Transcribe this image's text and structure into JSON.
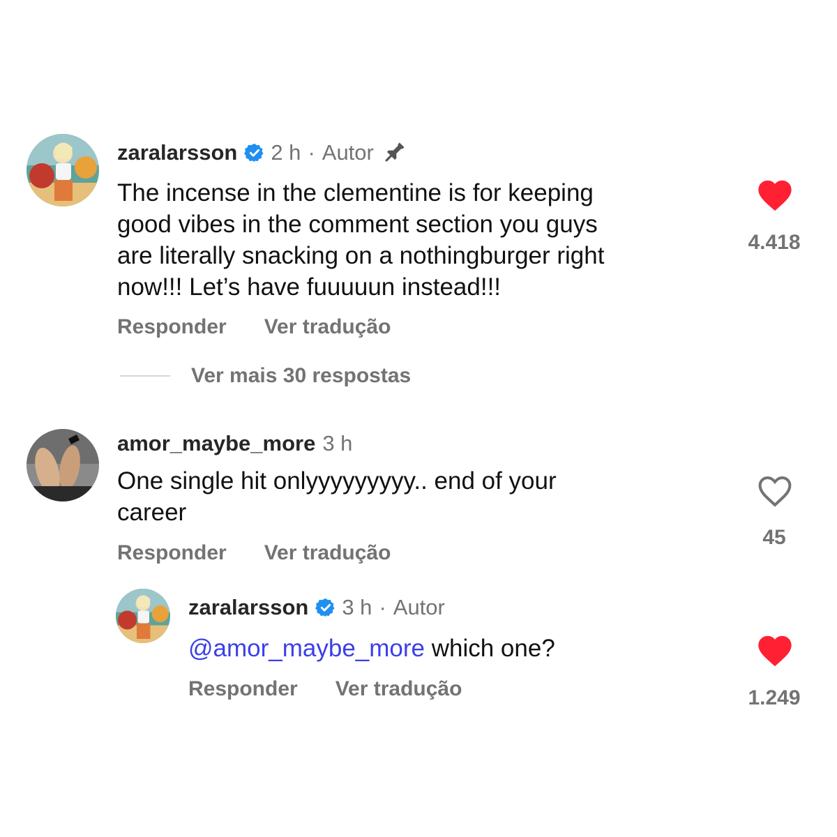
{
  "comments": [
    {
      "username": "zaralarsson",
      "verified": true,
      "time": "2 h",
      "separator": "·",
      "author_label": "Autor",
      "pinned": true,
      "text": "The incense in the clementine is for keeping\ngood vibes in the comment section you guys\nare literally snacking on a nothingburger right\nnow!!! Let’s have fuuuuun instead!!!",
      "reply_label": "Responder",
      "translate_label": "Ver tradução",
      "liked": true,
      "like_count": "4.418",
      "view_replies_label": "Ver mais 30 respostas"
    },
    {
      "username": "amor_maybe_more",
      "verified": false,
      "time": "3 h",
      "text": "One single hit onlyyyyyyyyy.. end of your\ncareer",
      "reply_label": "Responder",
      "translate_label": "Ver tradução",
      "liked": false,
      "like_count": "45"
    },
    {
      "username": "zaralarsson",
      "verified": true,
      "time": "3 h",
      "separator": "·",
      "author_label": "Autor",
      "mention": "@amor_maybe_more",
      "text": " which one?",
      "reply_label": "Responder",
      "translate_label": "Ver tradução",
      "liked": true,
      "like_count": "1.249"
    }
  ],
  "colors": {
    "like_red": "#ff2033",
    "verified_blue": "#1f8ff2",
    "mention_blue": "#3b3fe8",
    "secondary_gray": "#737373"
  },
  "icons": {
    "verified": "verified-badge-icon",
    "pin": "pin-icon",
    "heart_filled": "heart-filled-icon",
    "heart_outline": "heart-outline-icon"
  }
}
